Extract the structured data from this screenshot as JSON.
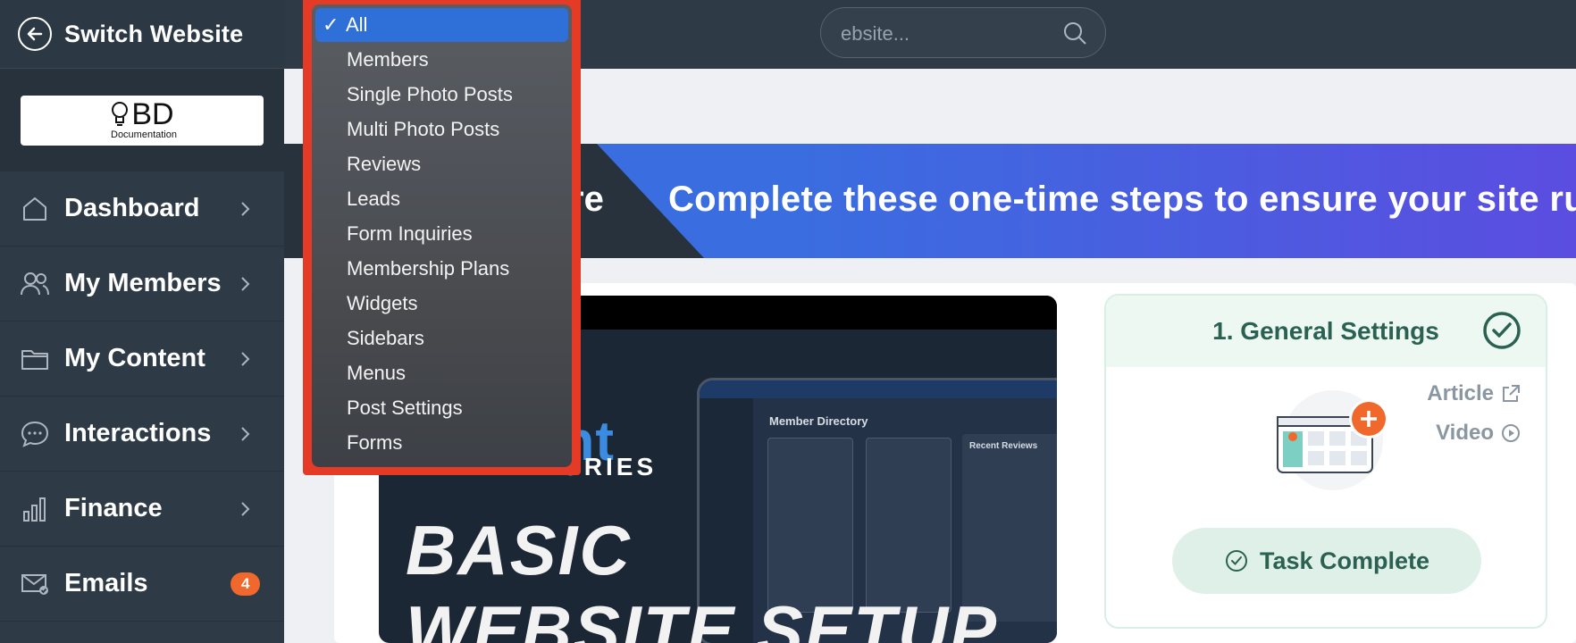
{
  "sidebar": {
    "switch_label": "Switch Website",
    "logo_text": "BD",
    "logo_subtext": "Documentation",
    "items": [
      {
        "label": "Dashboard",
        "icon": "home-icon"
      },
      {
        "label": "My Members",
        "icon": "users-icon"
      },
      {
        "label": "My Content",
        "icon": "folder-icon"
      },
      {
        "label": "Interactions",
        "icon": "chat-icon"
      },
      {
        "label": "Finance",
        "icon": "bar-chart-icon"
      },
      {
        "label": "Emails",
        "icon": "mail-check-icon",
        "badge": "4"
      }
    ]
  },
  "search": {
    "placeholder": "ebsite..."
  },
  "dropdown": {
    "selected": "All",
    "options": [
      "All",
      "Members",
      "Single Photo Posts",
      "Multi Photo Posts",
      "Reviews",
      "Leads",
      "Form Inquiries",
      "Membership Plans",
      "Widgets",
      "Sidebars",
      "Menus",
      "Post Settings",
      "Forms"
    ]
  },
  "banner": {
    "left_text": "re",
    "right_text": "Complete these one-time steps to ensure your site ru"
  },
  "video": {
    "brand_top": "ant",
    "brand_bottom": "ORIES",
    "title_line1": "BASIC",
    "title_line2": "WEBSITE SETUP",
    "screen_heading": "Member Directory",
    "screen_sidebar_title": "Recent Reviews"
  },
  "task": {
    "title": "1. General Settings",
    "article_label": "Article",
    "video_label": "Video",
    "complete_label": "Task Complete"
  },
  "colors": {
    "sidebar_bg": "#2e3a46",
    "accent_blue": "#3a6de0",
    "badge_orange": "#f0682b",
    "dropdown_highlight": "#e53b26",
    "task_green": "#2b6152"
  }
}
